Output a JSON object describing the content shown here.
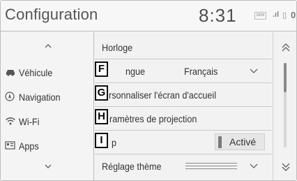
{
  "header": {
    "title": "Configuration",
    "clock": "8:31",
    "status": {
      "badge": "ᴰᴱᴹ",
      "signal": ".ıl",
      "battery": "▯",
      "zero": "0"
    }
  },
  "sidebar": {
    "items": [
      {
        "label": "Véhicule",
        "icon": "car-icon"
      },
      {
        "label": "Navigation",
        "icon": "navigation-icon"
      },
      {
        "label": "Wi-Fi",
        "icon": "wifi-icon"
      },
      {
        "label": "Apps",
        "icon": "apps-icon"
      }
    ]
  },
  "list": {
    "rows": [
      {
        "label": "Horloge"
      },
      {
        "marker": "F",
        "label": "ngue",
        "value": "Français"
      },
      {
        "marker": "G",
        "label": "rsonnaliser l'écran d'accueil"
      },
      {
        "marker": "H",
        "label": "ramètres de projection"
      },
      {
        "marker": "I",
        "label": "p",
        "toggle": "Activé"
      },
      {
        "label": "Réglage thème"
      }
    ]
  },
  "scroll": {
    "position": 0.0
  },
  "colors": {
    "background": "#f2f2f2",
    "divider": "#bcbcbc",
    "text": "#333333",
    "toggle_knob": "#7a7a7a"
  }
}
